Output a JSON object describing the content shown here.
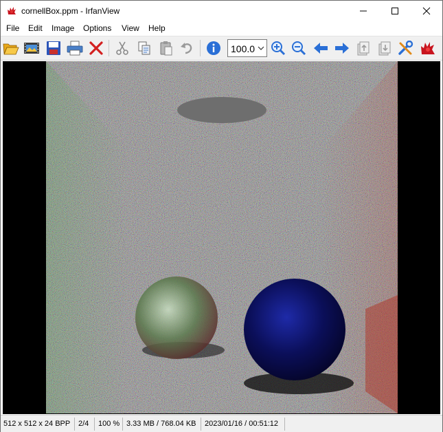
{
  "window": {
    "title": "cornellBox.ppm - IrfanView",
    "app_icon": "irfanview-red-cat-icon",
    "controls": [
      "minimize-icon",
      "maximize-icon",
      "close-icon"
    ]
  },
  "menu": {
    "items": [
      "File",
      "Edit",
      "Image",
      "Options",
      "View",
      "Help"
    ]
  },
  "toolbar": {
    "buttons": [
      "open-folder-icon",
      "slideshow-icon",
      "save-icon",
      "print-icon",
      "delete-icon",
      "cut-icon",
      "copy-icon",
      "paste-icon",
      "undo-icon",
      "info-icon",
      "zoom-in-icon",
      "zoom-out-icon",
      "previous-icon",
      "next-icon",
      "first-page-icon",
      "last-page-icon",
      "settings-icon",
      "irfanview-logo-icon"
    ],
    "zoom_value": "100.0"
  },
  "image": {
    "description_name": "cornell-box-render"
  },
  "status": {
    "dimensions": "512 x 512 x 24 BPP",
    "index": "2/4",
    "zoom": "100 %",
    "size": "3.33 MB / 768.04 KB",
    "datetime": "2023/01/16 / 00:51:12"
  },
  "colors": {
    "toolbar_bg": "#f0f0f0",
    "viewer_bg": "#000000",
    "accent_blue": "#2a6fd6",
    "delete_red": "#d32020"
  }
}
